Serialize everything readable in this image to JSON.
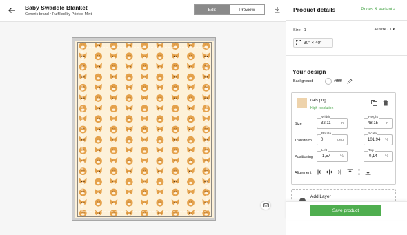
{
  "header": {
    "title": "Baby Swaddle Blanket",
    "subtitle": "Generic brand • Fulfilled by Printed Mint",
    "edit_label": "Edit",
    "preview_label": "Preview"
  },
  "panel": {
    "title": "Product details",
    "prices_link": "Prices & variants",
    "size_label": "Size · 1",
    "all_size": "All size · 1",
    "size_value": "30″ × 40″",
    "design_title": "Your design",
    "background_label": "Background",
    "background_hex": "#ffffff"
  },
  "layer": {
    "file_name": "cats.png",
    "resolution": "High resolution",
    "size_label": "Size",
    "transform_label": "Transform",
    "positioning_label": "Positioning",
    "alignment_label": "Aligement",
    "width": {
      "label": "Width",
      "value": "32,11",
      "unit": "in"
    },
    "height": {
      "label": "Height",
      "value": "48,15",
      "unit": "in"
    },
    "rotate": {
      "label": "Rotate",
      "value": "0",
      "unit": "deg"
    },
    "scale": {
      "label": "Scale",
      "value": "101,94",
      "unit": "%"
    },
    "left": {
      "label": "Left",
      "value": "-1,57",
      "unit": "%"
    },
    "top": {
      "label": "Top",
      "value": "-0,14",
      "unit": "%"
    }
  },
  "add_layer_label": "Add Layer",
  "save_label": "Save product",
  "colors": {
    "accent": "#4fae4f",
    "pattern_bg": "#fdf1d9",
    "cat_orange": "#e5a24c"
  },
  "icons": [
    "back-arrow-icon",
    "download-icon",
    "fullscreen-icon",
    "pencil-icon",
    "copy-icon",
    "trash-icon",
    "align-left-icon",
    "align-center-h-icon",
    "align-right-icon",
    "align-top-icon",
    "align-middle-v-icon",
    "align-bottom-icon",
    "keyboard-icon",
    "plus-icon"
  ]
}
